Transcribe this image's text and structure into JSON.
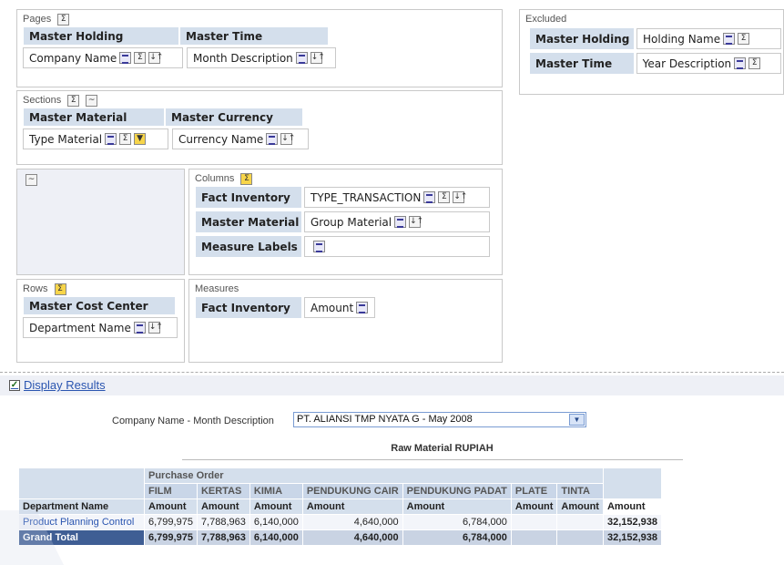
{
  "pages": {
    "title": "Pages",
    "headers": [
      "Master Holding",
      "Master Time"
    ],
    "cells": [
      "Company Name",
      "Month Description"
    ]
  },
  "excluded": {
    "title": "Excluded",
    "rows": [
      {
        "header": "Master Holding",
        "cell": "Holding Name"
      },
      {
        "header": "Master Time",
        "cell": "Year Description"
      }
    ]
  },
  "sections": {
    "title": "Sections",
    "headers": [
      "Master Material",
      "Master Currency"
    ],
    "cells": [
      "Type Material",
      "Currency Name"
    ]
  },
  "columns": {
    "title": "Columns",
    "rows": [
      {
        "header": "Fact Inventory",
        "cell": "TYPE_TRANSACTION"
      },
      {
        "header": "Master Material",
        "cell": "Group Material"
      },
      {
        "header": "Measure Labels",
        "cell": ""
      }
    ]
  },
  "rows_panel": {
    "title": "Rows",
    "header": "Master Cost Center",
    "cell": "Department Name"
  },
  "measures": {
    "title": "Measures",
    "header": "Fact Inventory",
    "cell": "Amount"
  },
  "icons": {
    "sigma": "Σ",
    "sort": "↓↑",
    "dropdown": "▼",
    "check": "✓"
  },
  "results": {
    "display_results_label": "Display Results",
    "filter_label": "Company Name - Month Description",
    "filter_value": "PT. ALIANSI TMP NYATA G - May 2008",
    "report_title": "Raw Material RUPIAH"
  },
  "pivot": {
    "group_header": "Purchase Order",
    "categories": [
      "FILM",
      "KERTAS",
      "KIMIA",
      "PENDUKUNG CAIR",
      "PENDUKUNG PADAT",
      "PLATE",
      "TINTA"
    ],
    "measure_label": "Amount",
    "row_header": "Department Name",
    "total_header": "Amount",
    "rows": [
      {
        "label": "Product Planning Control",
        "values": [
          "6,799,975",
          "7,788,963",
          "6,140,000",
          "4,640,000",
          "6,784,000",
          "",
          ""
        ],
        "total": "32,152,938"
      }
    ],
    "grand_total": {
      "label": "Grand Total",
      "values": [
        "6,799,975",
        "7,788,963",
        "6,140,000",
        "4,640,000",
        "6,784,000",
        "",
        ""
      ],
      "total": "32,152,938"
    }
  }
}
